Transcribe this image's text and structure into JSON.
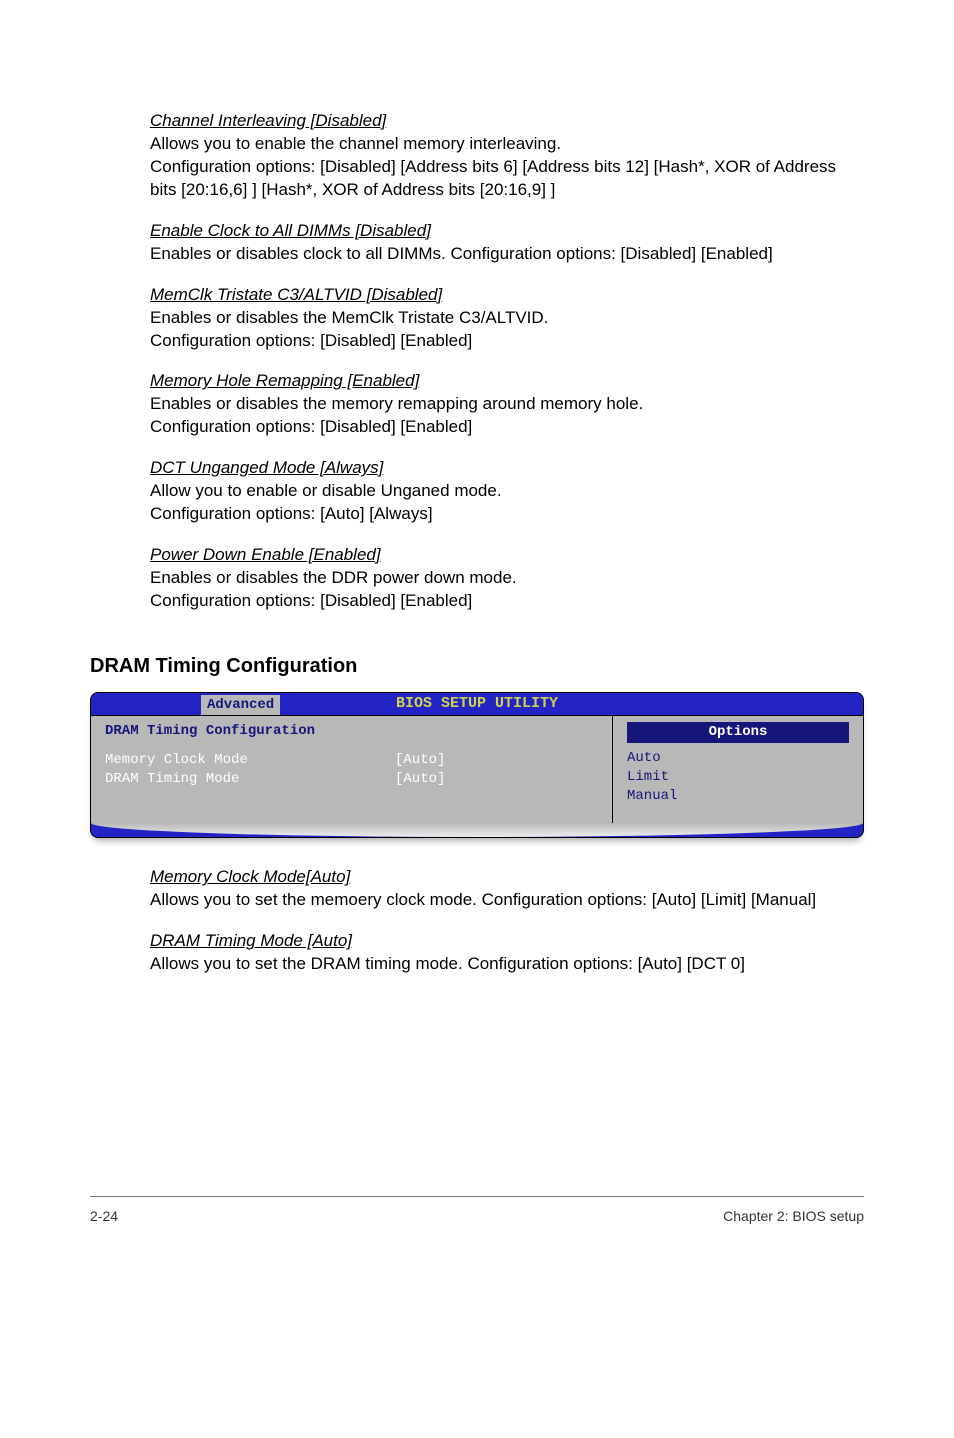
{
  "sections": {
    "channelInterleaving": {
      "heading": "Channel Interleaving [Disabled]",
      "l1": "Allows you to enable the channel memory interleaving.",
      "l2": "Configuration options: [Disabled] [Address bits 6] [Address bits 12] [Hash*, XOR of Address bits [20:16,6] ] [Hash*, XOR of Address bits [20:16,9] ]"
    },
    "enableClock": {
      "heading": "Enable Clock to All DIMMs [Disabled]",
      "l1": "Enables or disables clock to all DIMMs. Configuration options: [Disabled] [Enabled]"
    },
    "memclk": {
      "heading": "MemClk Tristate C3/ALTVID [Disabled]",
      "l1": "Enables or disables the MemClk Tristate C3/ALTVID.",
      "l2": "Configuration options: [Disabled] [Enabled]"
    },
    "memoryHole": {
      "heading": "Memory Hole Remapping [Enabled]",
      "l1": "Enables or disables the memory remapping around memory hole.",
      "l2": "Configuration options: [Disabled] [Enabled]"
    },
    "dctUnganged": {
      "heading": "DCT Unganged Mode [Always]",
      "l1": "Allow you to enable or disable Unganed mode.",
      "l2": "Configuration options: [Auto] [Always]"
    },
    "powerDown": {
      "heading": "Power Down Enable [Enabled]",
      "l1": "Enables or disables the DDR power down mode.",
      "l2": "Configuration options: [Disabled] [Enabled]"
    },
    "memoryClockMode": {
      "heading": "Memory Clock Mode[Auto]",
      "l1": "Allows you to set the memoery clock mode. Configuration options: [Auto] [Limit] [Manual]"
    },
    "dramTimingMode": {
      "heading": "DRAM Timing Mode [Auto]",
      "l1": "Allows you to set the DRAM timing mode. Configuration options: [Auto] [DCT 0]"
    }
  },
  "docHeading": "DRAM Timing Configuration",
  "bios": {
    "title": "BIOS SETUP UTILITY",
    "tab": "Advanced",
    "subheader": "DRAM Timing Configuration",
    "rows": [
      {
        "k": "Memory Clock Mode",
        "v": "[Auto]"
      },
      {
        "k": "DRAM Timing Mode",
        "v": "[Auto]"
      }
    ],
    "optionsHeader": "Options",
    "options": [
      "Auto",
      "Limit",
      "Manual"
    ]
  },
  "footer": {
    "left": "2-24",
    "right": "Chapter 2: BIOS setup"
  }
}
